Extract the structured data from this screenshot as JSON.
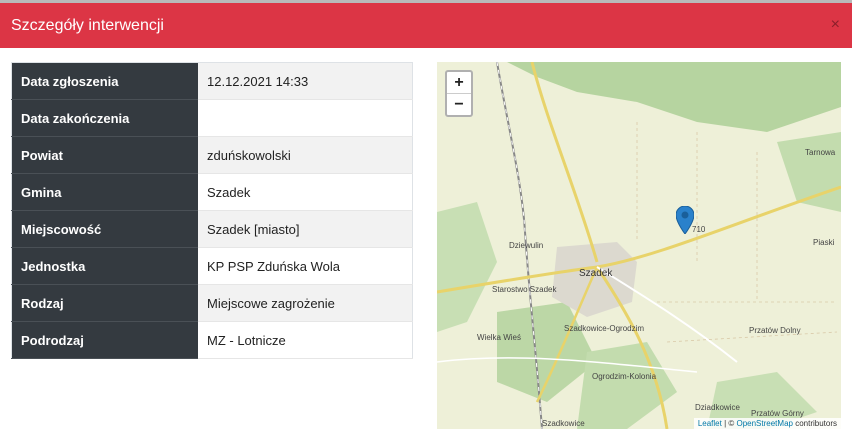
{
  "header": {
    "title": "Szczegóły interwencji",
    "close_label": "×"
  },
  "details": [
    {
      "label": "Data zgłoszenia",
      "value": "12.12.2021 14:33"
    },
    {
      "label": "Data zakończenia",
      "value": ""
    },
    {
      "label": "Powiat",
      "value": "zduńskowolski"
    },
    {
      "label": "Gmina",
      "value": "Szadek"
    },
    {
      "label": "Miejscowość",
      "value": "Szadek [miasto]"
    },
    {
      "label": "Jednostka",
      "value": "KP PSP Zduńska Wola"
    },
    {
      "label": "Rodzaj",
      "value": "Miejscowe zagrożenie"
    },
    {
      "label": "Podrodzaj",
      "value": "MZ - Lotnicze"
    }
  ],
  "map": {
    "zoom_in": "+",
    "zoom_out": "−",
    "attribution": {
      "leaflet": "Leaflet",
      "sep": " | © ",
      "osm": "OpenStreetMap",
      "rest": " contributors"
    },
    "places": {
      "szadek": "Szadek",
      "tarnowa": "Tarnowa",
      "piaski": "Piaski",
      "dziewulin": "Dziewulin",
      "starostwo": "Starostwo Szadek",
      "szadkowice_ogrodzim": "Szadkowice-Ogrodzim",
      "wielka_wies": "Wielka Wieś",
      "przatow_dolny": "Przatów Dolny",
      "ogrodzim_kolonia": "Ogrodzim-Kolonia",
      "dziadkowice": "Dziadkowice",
      "przatow_gorny": "Przatów Górny",
      "szadkowice": "Szadkowice",
      "road_710": "710"
    },
    "colors": {
      "forest": "#b6d4a0",
      "farmland": "#eef0d8",
      "road": "#f5e89a",
      "marker": "#2a81cb"
    }
  }
}
